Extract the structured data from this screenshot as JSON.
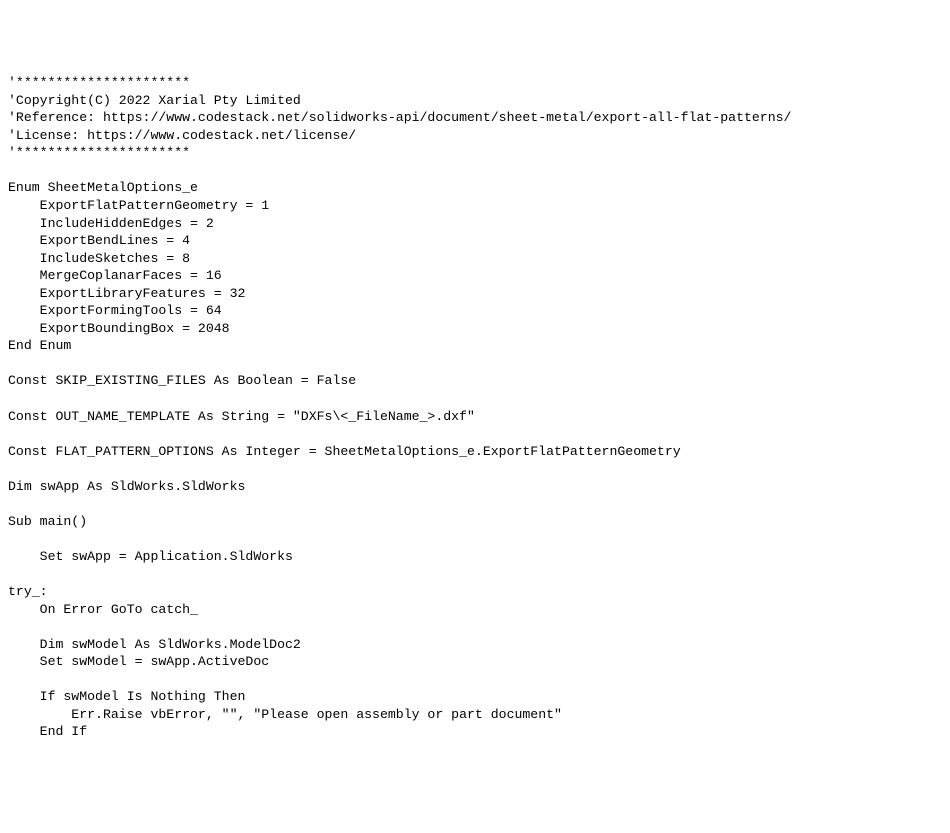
{
  "code": {
    "lines": [
      "'**********************",
      "'Copyright(C) 2022 Xarial Pty Limited",
      "'Reference: https://www.codestack.net/solidworks-api/document/sheet-metal/export-all-flat-patterns/",
      "'License: https://www.codestack.net/license/",
      "'**********************",
      "",
      "Enum SheetMetalOptions_e",
      "    ExportFlatPatternGeometry = 1",
      "    IncludeHiddenEdges = 2",
      "    ExportBendLines = 4",
      "    IncludeSketches = 8",
      "    MergeCoplanarFaces = 16",
      "    ExportLibraryFeatures = 32",
      "    ExportFormingTools = 64",
      "    ExportBoundingBox = 2048",
      "End Enum",
      "",
      "Const SKIP_EXISTING_FILES As Boolean = False",
      "",
      "Const OUT_NAME_TEMPLATE As String = \"DXFs\\<_FileName_>.dxf\"",
      "",
      "Const FLAT_PATTERN_OPTIONS As Integer = SheetMetalOptions_e.ExportFlatPatternGeometry",
      "",
      "Dim swApp As SldWorks.SldWorks",
      "",
      "Sub main()",
      "",
      "    Set swApp = Application.SldWorks",
      "",
      "try_:",
      "    On Error GoTo catch_",
      "",
      "    Dim swModel As SldWorks.ModelDoc2",
      "    Set swModel = swApp.ActiveDoc",
      "",
      "    If swModel Is Nothing Then",
      "        Err.Raise vbError, \"\", \"Please open assembly or part document\"",
      "    End If"
    ]
  }
}
